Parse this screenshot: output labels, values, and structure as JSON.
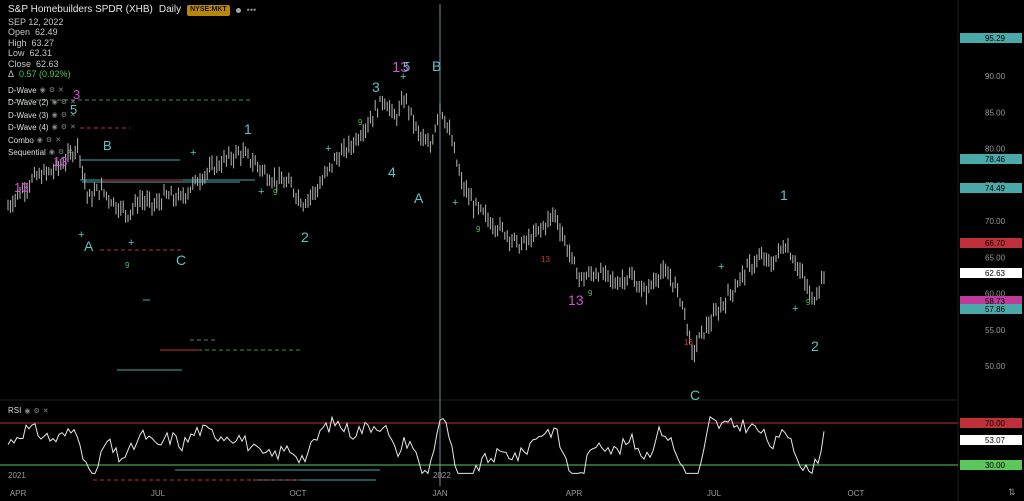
{
  "header": {
    "symbol_title": "S&P Homebuilders SPDR (XHB)",
    "interval": "Daily",
    "exchange_badge": "NYSE:MKT",
    "date": "SEP 12, 2022",
    "ohlc": [
      {
        "label": "Open",
        "value": "62.49"
      },
      {
        "label": "High",
        "value": "63.27"
      },
      {
        "label": "Low",
        "value": "62.31"
      },
      {
        "label": "Close",
        "value": "62.63"
      }
    ],
    "change_symbol": "Δ",
    "change": "0.57 (0.92%)"
  },
  "indicators": [
    {
      "label": "D-Wave"
    },
    {
      "label": "D-Wave (2)"
    },
    {
      "label": "D-Wave (3)"
    },
    {
      "label": "D-Wave (4)"
    },
    {
      "label": "Combo"
    },
    {
      "label": "Sequential"
    }
  ],
  "rsi_label": "RSI",
  "price_axis": [
    "90.00",
    "85.00",
    "80.00",
    "75.00",
    "70.00",
    "65.00",
    "60.00",
    "55.00",
    "50.00"
  ],
  "price_tags": [
    {
      "value": "95.29",
      "color": "#4aa9a9",
      "text_color": "#000"
    },
    {
      "value": "78.46",
      "color": "#4aa9a9",
      "text_color": "#000"
    },
    {
      "value": "74.49",
      "color": "#4aa9a9",
      "text_color": "#000"
    },
    {
      "value": "66.70",
      "color": "#c0303a",
      "text_color": "#000"
    },
    {
      "value": "62.63",
      "color": "#ffffff",
      "text_color": "#000"
    },
    {
      "value": "58.73",
      "color": "#c03a9a",
      "text_color": "#000"
    },
    {
      "value": "57.86",
      "color": "#4aa9a9",
      "text_color": "#000"
    }
  ],
  "rsi_tags": [
    {
      "value": "70.00",
      "color": "#c0303a",
      "text_color": "#000"
    },
    {
      "value": "53.07",
      "color": "#ffffff",
      "text_color": "#000"
    },
    {
      "value": "30.00",
      "color": "#5cc85c",
      "text_color": "#000"
    }
  ],
  "time_axis": [
    {
      "label": "APR"
    },
    {
      "label": "JUL"
    },
    {
      "label": "OCT"
    },
    {
      "label": "JAN"
    },
    {
      "label": "APR"
    },
    {
      "label": "JUL"
    },
    {
      "label": "OCT"
    }
  ],
  "year_labels": [
    "2021",
    "2022"
  ],
  "wave_labels": [
    {
      "text": "13",
      "color": "#d24fd2"
    },
    {
      "text": "13",
      "color": "#d24fd2"
    },
    {
      "text": "5",
      "color": "#5fc4c4"
    },
    {
      "text": "3",
      "color": "#d24fd2"
    },
    {
      "text": "B",
      "color": "#5fc4c4"
    },
    {
      "text": "A",
      "color": "#5fc4c4"
    },
    {
      "text": "C",
      "color": "#5fc4c4"
    },
    {
      "text": "1",
      "color": "#5fc4c4"
    },
    {
      "text": "2",
      "color": "#5fc4c4"
    },
    {
      "text": "3",
      "color": "#5fc4c4"
    },
    {
      "text": "4",
      "color": "#5fc4c4"
    },
    {
      "text": "13",
      "color": "#d24fd2"
    },
    {
      "text": "5",
      "color": "#5fc4c4"
    },
    {
      "text": "B",
      "color": "#5fc4c4"
    },
    {
      "text": "A",
      "color": "#5fc4c4"
    },
    {
      "text": "13",
      "color": "#d24fd2"
    },
    {
      "text": "C",
      "color": "#5fc4c4"
    },
    {
      "text": "1",
      "color": "#5fc4c4"
    },
    {
      "text": "2",
      "color": "#5fc4c4"
    }
  ],
  "colors": {
    "background": "#000000",
    "candle": "#b8b8b8",
    "teal_line": "#4aa9a9",
    "red_line": "#c0303a",
    "green_line": "#3a9a3a",
    "rsi_line": "#e8e8e8",
    "crosshair": "#6f8f9f"
  }
}
